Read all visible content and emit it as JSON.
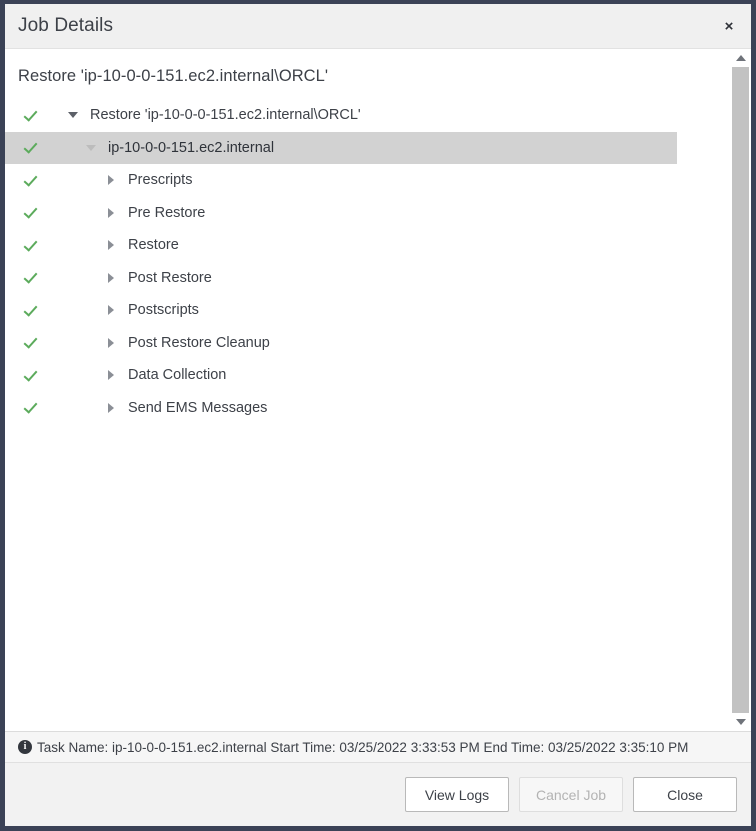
{
  "dialog": {
    "title": "Job Details",
    "close_label": "×",
    "heading": "Restore 'ip-10-0-0-151.ec2.internal\\ORCL'"
  },
  "tree": {
    "items": [
      {
        "label": "Restore 'ip-10-0-0-151.ec2.internal\\ORCL'",
        "level": 0,
        "state": "success",
        "expanded": true,
        "selected": false
      },
      {
        "label": "ip-10-0-0-151.ec2.internal",
        "level": 1,
        "state": "success",
        "expanded": true,
        "selected": true
      },
      {
        "label": "Prescripts",
        "level": 2,
        "state": "success",
        "expanded": false,
        "selected": false
      },
      {
        "label": "Pre Restore",
        "level": 2,
        "state": "success",
        "expanded": false,
        "selected": false
      },
      {
        "label": "Restore",
        "level": 2,
        "state": "success",
        "expanded": false,
        "selected": false
      },
      {
        "label": "Post Restore",
        "level": 2,
        "state": "success",
        "expanded": false,
        "selected": false
      },
      {
        "label": "Postscripts",
        "level": 2,
        "state": "success",
        "expanded": false,
        "selected": false
      },
      {
        "label": "Post Restore Cleanup",
        "level": 2,
        "state": "success",
        "expanded": false,
        "selected": false
      },
      {
        "label": "Data Collection",
        "level": 2,
        "state": "success",
        "expanded": false,
        "selected": false
      },
      {
        "label": "Send EMS Messages",
        "level": 2,
        "state": "success",
        "expanded": false,
        "selected": false
      }
    ]
  },
  "statusbar": {
    "text": "Task Name: ip-10-0-0-151.ec2.internal Start Time: 03/25/2022 3:33:53 PM End Time: 03/25/2022 3:35:10 PM",
    "task_name": "ip-10-0-0-151.ec2.internal",
    "start_time": "03/25/2022 3:33:53 PM",
    "end_time": "03/25/2022 3:35:10 PM",
    "info_glyph": "i"
  },
  "footer": {
    "buttons": [
      {
        "label": "View Logs",
        "disabled": false
      },
      {
        "label": "Cancel Job",
        "disabled": true
      },
      {
        "label": "Close",
        "disabled": false
      }
    ]
  },
  "colors": {
    "dialog_border": "#3b4256",
    "titlebar_bg": "#f0f0f0",
    "selected_row": "#d2d2d2",
    "success_check": "#5cab5c",
    "text": "#3d4148",
    "footer_bg": "#f2f2f2",
    "scrollbar_thumb": "#c2c2c2"
  }
}
